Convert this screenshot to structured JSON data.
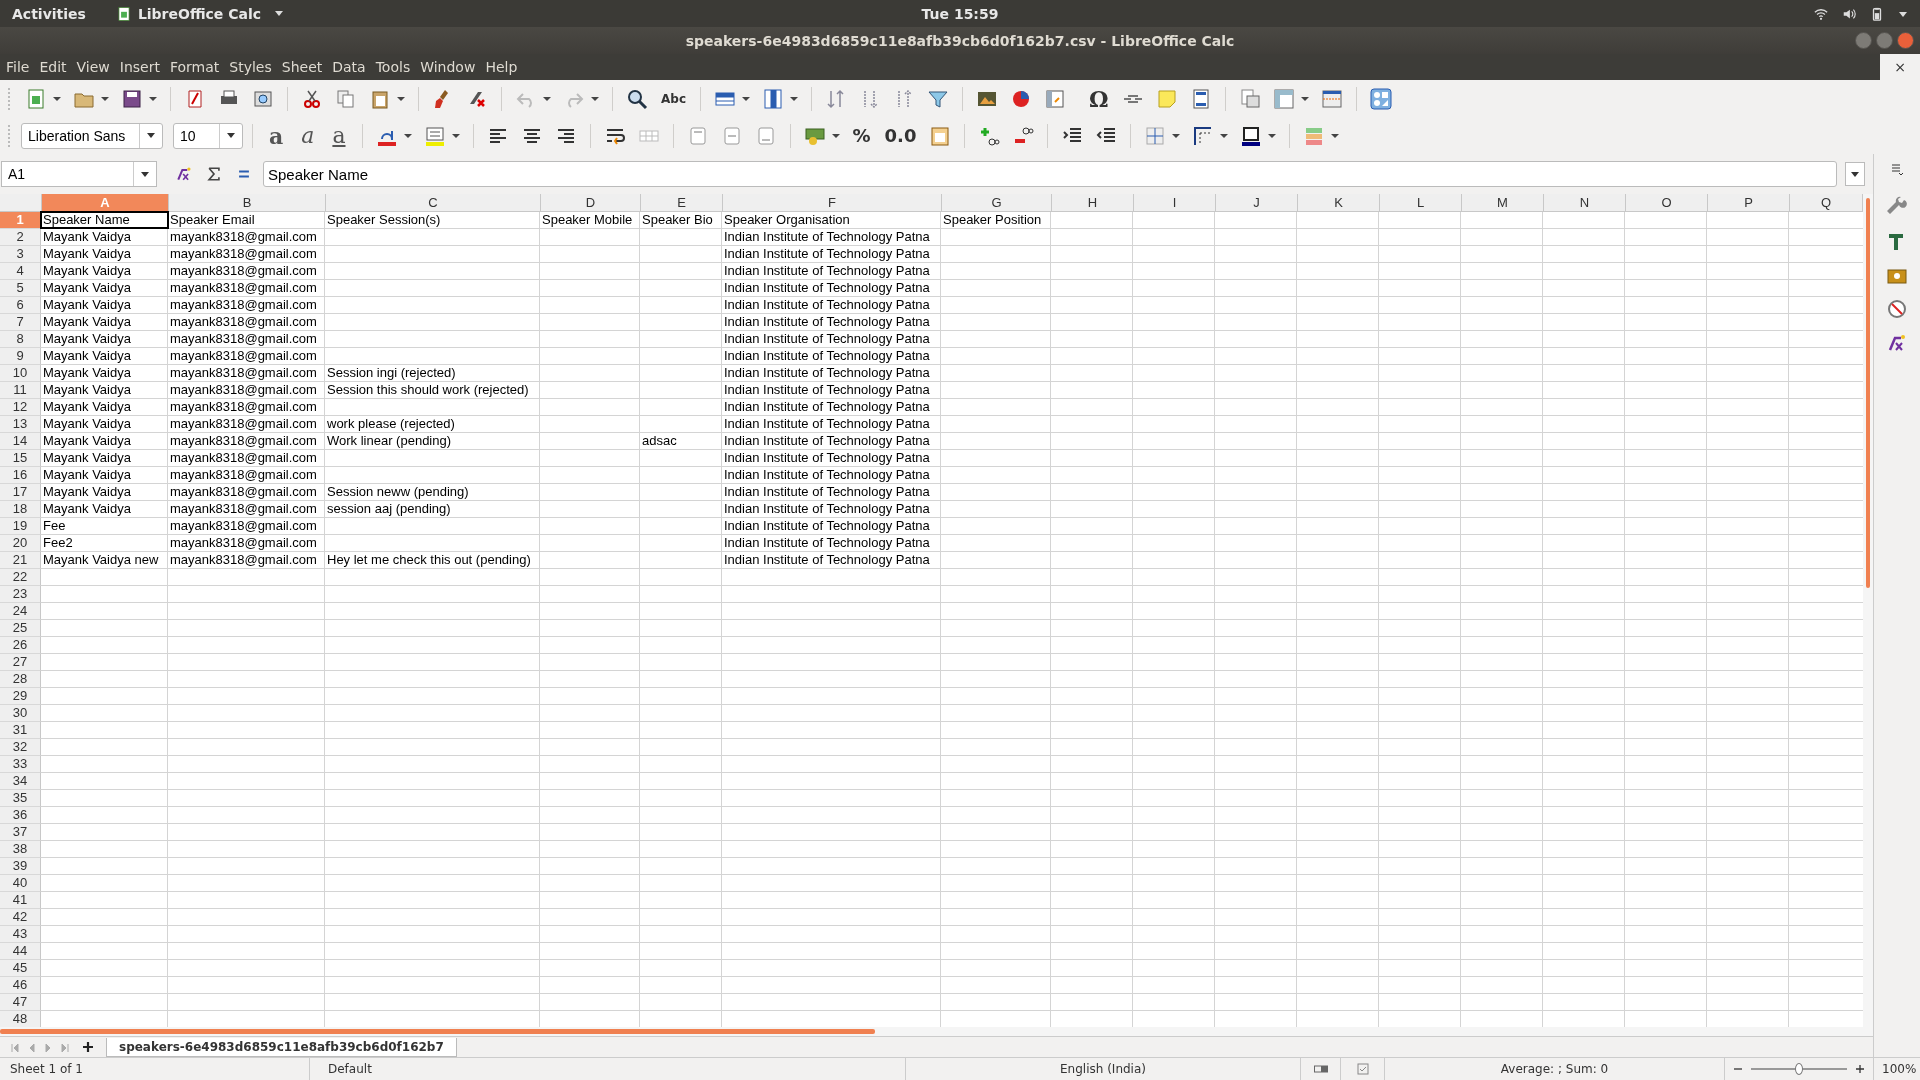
{
  "top_bar": {
    "activities": "Activities",
    "app_name": "LibreOffice Calc",
    "clock": "Tue 15:59"
  },
  "window": {
    "title": "speakers-6e4983d6859c11e8afb39cb6d0f162b7.csv - LibreOffice Calc",
    "close_document": "×"
  },
  "menu": [
    "File",
    "Edit",
    "View",
    "Insert",
    "Format",
    "Styles",
    "Sheet",
    "Data",
    "Tools",
    "Window",
    "Help"
  ],
  "formatting": {
    "font_name": "Liberation Sans",
    "font_size": "10",
    "glyph_buttons": [
      {
        "text": "a",
        "kind": "bold"
      },
      {
        "text": "a",
        "kind": "italic"
      },
      {
        "text": "a",
        "kind": "underline"
      }
    ],
    "number_buttons": [
      "%",
      "0.0"
    ]
  },
  "standard_toolbar": {
    "spelling": "Abc",
    "special_character": "Ω"
  },
  "formula_bar": {
    "cell_reference": "A1",
    "content": "Speaker Name"
  },
  "columns": [
    {
      "letter": "A",
      "selected": true
    },
    {
      "letter": "B",
      "selected": false
    },
    {
      "letter": "C",
      "selected": false
    },
    {
      "letter": "D",
      "selected": false
    },
    {
      "letter": "E",
      "selected": false
    },
    {
      "letter": "F",
      "selected": false
    },
    {
      "letter": "G",
      "selected": false
    },
    {
      "letter": "H",
      "selected": false
    },
    {
      "letter": "I",
      "selected": false
    },
    {
      "letter": "J",
      "selected": false
    },
    {
      "letter": "K",
      "selected": false
    },
    {
      "letter": "L",
      "selected": false
    },
    {
      "letter": "M",
      "selected": false
    },
    {
      "letter": "N",
      "selected": false
    },
    {
      "letter": "O",
      "selected": false
    },
    {
      "letter": "P",
      "selected": false
    },
    {
      "letter": "Q",
      "selected": false
    }
  ],
  "rows": [
    {
      "number": "1",
      "selected": true,
      "cells": [
        "Speaker Name",
        "Speaker Email",
        "Speaker Session(s)",
        "Speaker Mobile",
        "Speaker Bio",
        "Speaker Organisation",
        "Speaker Position"
      ]
    },
    {
      "number": "2",
      "selected": false,
      "cells": [
        "Mayank Vaidya",
        "mayank8318@gmail.com",
        null,
        null,
        null,
        "Indian Institute of Technology Patna"
      ]
    },
    {
      "number": "3",
      "selected": false,
      "cells": [
        "Mayank Vaidya",
        "mayank8318@gmail.com",
        null,
        null,
        null,
        "Indian Institute of Technology Patna"
      ]
    },
    {
      "number": "4",
      "selected": false,
      "cells": [
        "Mayank Vaidya",
        "mayank8318@gmail.com",
        null,
        null,
        null,
        "Indian Institute of Technology Patna"
      ]
    },
    {
      "number": "5",
      "selected": false,
      "cells": [
        "Mayank Vaidya",
        "mayank8318@gmail.com",
        null,
        null,
        null,
        "Indian Institute of Technology Patna"
      ]
    },
    {
      "number": "6",
      "selected": false,
      "cells": [
        "Mayank Vaidya",
        "mayank8318@gmail.com",
        null,
        null,
        null,
        "Indian Institute of Technology Patna"
      ]
    },
    {
      "number": "7",
      "selected": false,
      "cells": [
        "Mayank Vaidya",
        "mayank8318@gmail.com",
        null,
        null,
        null,
        "Indian Institute of Technology Patna"
      ]
    },
    {
      "number": "8",
      "selected": false,
      "cells": [
        "Mayank Vaidya",
        "mayank8318@gmail.com",
        null,
        null,
        null,
        "Indian Institute of Technology Patna"
      ]
    },
    {
      "number": "9",
      "selected": false,
      "cells": [
        "Mayank Vaidya",
        "mayank8318@gmail.com",
        null,
        null,
        null,
        "Indian Institute of Technology Patna"
      ]
    },
    {
      "number": "10",
      "selected": false,
      "cells": [
        "Mayank Vaidya",
        "mayank8318@gmail.com",
        "Session ingi (rejected)",
        null,
        null,
        "Indian Institute of Technology Patna"
      ]
    },
    {
      "number": "11",
      "selected": false,
      "cells": [
        "Mayank Vaidya",
        "mayank8318@gmail.com",
        "Session this should work (rejected)",
        null,
        null,
        "Indian Institute of Technology Patna"
      ]
    },
    {
      "number": "12",
      "selected": false,
      "cells": [
        "Mayank Vaidya",
        "mayank8318@gmail.com",
        null,
        null,
        null,
        "Indian Institute of Technology Patna"
      ]
    },
    {
      "number": "13",
      "selected": false,
      "cells": [
        "Mayank Vaidya",
        "mayank8318@gmail.com",
        "work please (rejected)",
        null,
        null,
        "Indian Institute of Technology Patna"
      ]
    },
    {
      "number": "14",
      "selected": false,
      "cells": [
        "Mayank Vaidya",
        "mayank8318@gmail.com",
        "Work linear (pending)",
        null,
        "adsac",
        "Indian Institute of Technology Patna"
      ]
    },
    {
      "number": "15",
      "selected": false,
      "cells": [
        "Mayank Vaidya",
        "mayank8318@gmail.com",
        null,
        null,
        null,
        "Indian Institute of Technology Patna"
      ]
    },
    {
      "number": "16",
      "selected": false,
      "cells": [
        "Mayank Vaidya",
        "mayank8318@gmail.com",
        null,
        null,
        null,
        "Indian Institute of Technology Patna"
      ]
    },
    {
      "number": "17",
      "selected": false,
      "cells": [
        "Mayank Vaidya",
        "mayank8318@gmail.com",
        "Session neww (pending)",
        null,
        null,
        "Indian Institute of Technology Patna"
      ]
    },
    {
      "number": "18",
      "selected": false,
      "cells": [
        "Mayank Vaidya",
        "mayank8318@gmail.com",
        "session aaj (pending)",
        null,
        null,
        "Indian Institute of Technology Patna"
      ]
    },
    {
      "number": "19",
      "selected": false,
      "cells": [
        "Fee",
        "mayank8318@gmail.com",
        null,
        null,
        null,
        "Indian Institute of Technology Patna"
      ]
    },
    {
      "number": "20",
      "selected": false,
      "cells": [
        "Fee2",
        "mayank8318@gmail.com",
        null,
        null,
        null,
        "Indian Institute of Technology Patna"
      ]
    },
    {
      "number": "21",
      "selected": false,
      "cells": [
        "Mayank Vaidya new",
        "mayank8318@gmail.com",
        "Hey let me check this out (pending)",
        null,
        null,
        "Indian Institute of Technology Patna"
      ]
    },
    {
      "number": "22",
      "selected": false
    },
    {
      "number": "23",
      "selected": false
    },
    {
      "number": "24",
      "selected": false
    },
    {
      "number": "25",
      "selected": false
    },
    {
      "number": "26",
      "selected": false
    },
    {
      "number": "27",
      "selected": false
    },
    {
      "number": "28",
      "selected": false
    },
    {
      "number": "29",
      "selected": false
    },
    {
      "number": "30",
      "selected": false
    },
    {
      "number": "31",
      "selected": false
    },
    {
      "number": "32",
      "selected": false
    },
    {
      "number": "33",
      "selected": false
    },
    {
      "number": "34",
      "selected": false
    },
    {
      "number": "35",
      "selected": false
    },
    {
      "number": "36",
      "selected": false
    },
    {
      "number": "37",
      "selected": false
    },
    {
      "number": "38",
      "selected": false
    },
    {
      "number": "39",
      "selected": false
    },
    {
      "number": "40",
      "selected": false
    },
    {
      "number": "41",
      "selected": false
    },
    {
      "number": "42",
      "selected": false
    },
    {
      "number": "43",
      "selected": false
    },
    {
      "number": "44",
      "selected": false
    },
    {
      "number": "45",
      "selected": false
    },
    {
      "number": "46",
      "selected": false
    },
    {
      "number": "47",
      "selected": false
    },
    {
      "number": "48",
      "selected": false
    }
  ],
  "sheet_tabs": [
    {
      "label": "speakers-6e4983d6859c11e8afb39cb6d0f162b7",
      "selected": true
    }
  ],
  "status_bar": {
    "sheet": "Sheet 1 of 1",
    "page_style": "Default",
    "language": "English (India)",
    "summary": "Average: ; Sum: 0",
    "zoom": "100%",
    "zoom_slider": {
      "level": 0.5
    }
  }
}
